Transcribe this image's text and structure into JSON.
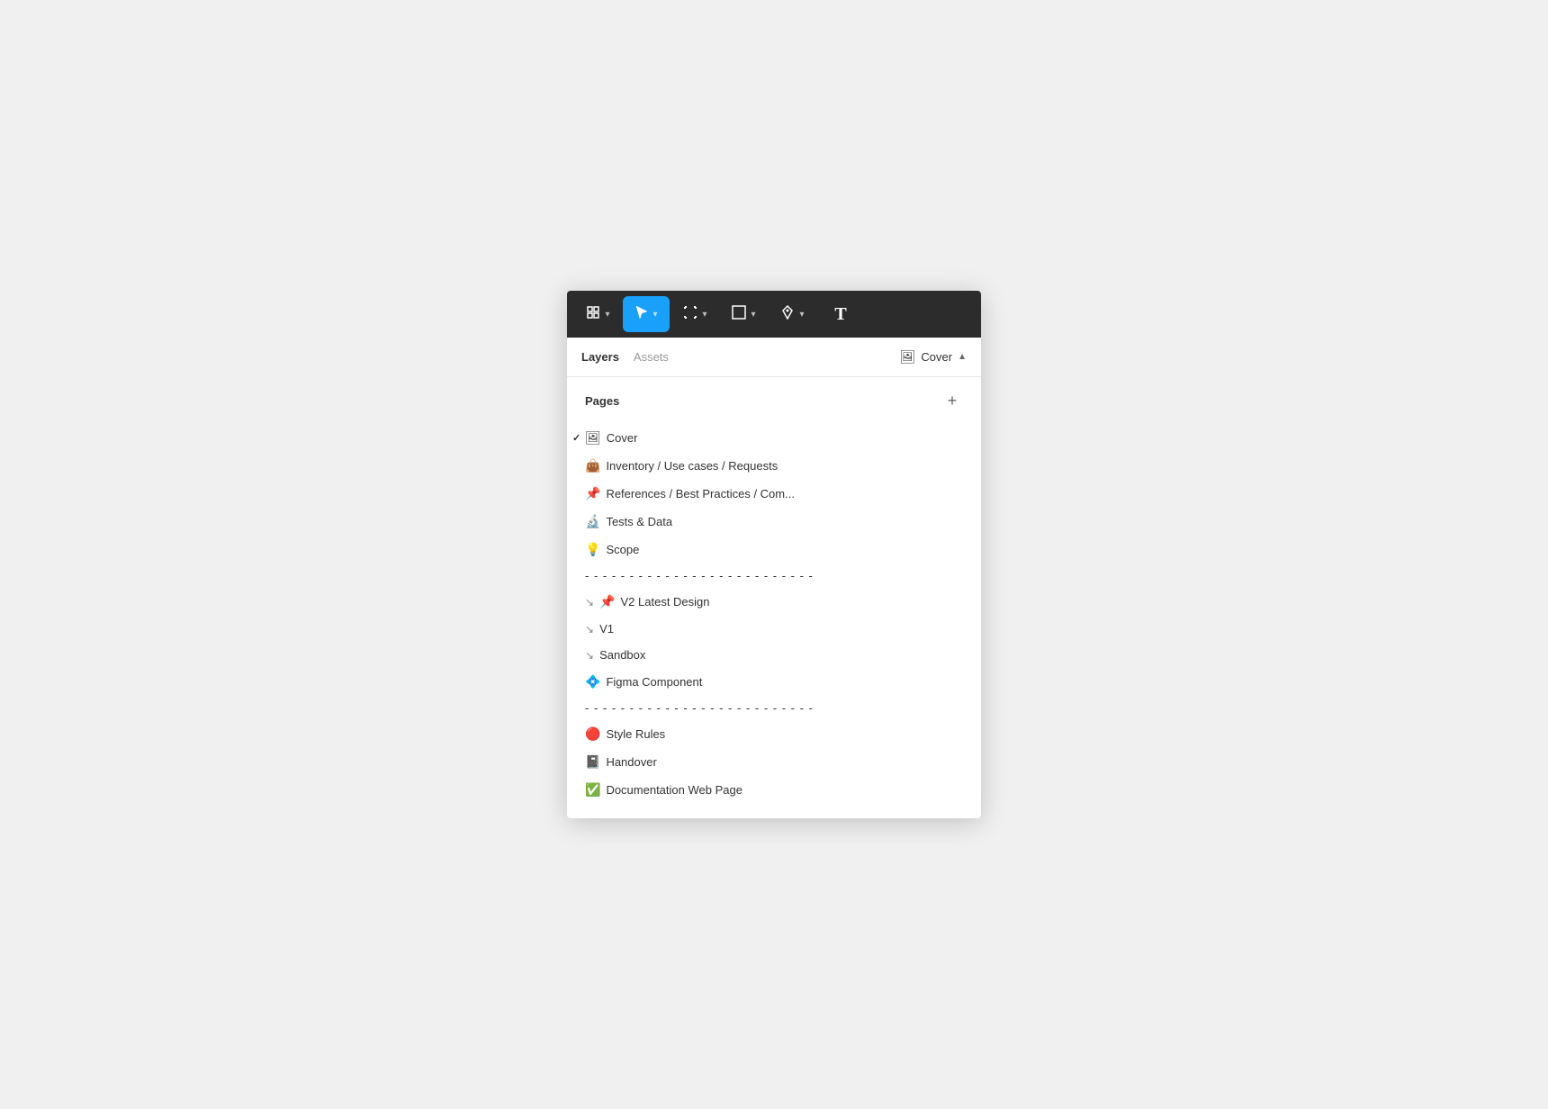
{
  "toolbar": {
    "tools": [
      {
        "id": "component",
        "icon": "⊞",
        "label": "Component tool",
        "active": false,
        "hasChevron": true
      },
      {
        "id": "cursor",
        "icon": "↖",
        "label": "Cursor tool",
        "active": true,
        "hasChevron": true
      },
      {
        "id": "frame",
        "icon": "#",
        "label": "Frame tool",
        "active": false,
        "hasChevron": true
      },
      {
        "id": "shape",
        "icon": "□",
        "label": "Shape tool",
        "active": false,
        "hasChevron": true
      },
      {
        "id": "pen",
        "icon": "✒",
        "label": "Pen tool",
        "active": false,
        "hasChevron": true
      },
      {
        "id": "text",
        "icon": "T",
        "label": "Text tool",
        "active": false,
        "hasChevron": false
      }
    ]
  },
  "panel": {
    "layers_tab": "Layers",
    "assets_tab": "Assets",
    "current_page_icon": "🖼",
    "current_page_name": "Cover",
    "chevron": "▲"
  },
  "pages_section": {
    "title": "Pages",
    "add_button": "+",
    "items": [
      {
        "id": "cover",
        "emoji": "🖼",
        "name": "Cover",
        "checked": true,
        "linked": false,
        "separator": false
      },
      {
        "id": "inventory",
        "emoji": "👜",
        "name": "Inventory / Use cases / Requests",
        "checked": false,
        "linked": false,
        "separator": false
      },
      {
        "id": "references",
        "emoji": "📌",
        "name": "References  / Best Practices / Com...",
        "checked": false,
        "linked": false,
        "separator": false
      },
      {
        "id": "tests",
        "emoji": "🔬",
        "name": "Tests & Data",
        "checked": false,
        "linked": false,
        "separator": false
      },
      {
        "id": "scope",
        "emoji": "💡",
        "name": "Scope",
        "checked": false,
        "linked": false,
        "separator": false
      },
      {
        "id": "sep1",
        "emoji": "",
        "name": "- - - - - - - - - - - - - - - - - - - - - - - - - -",
        "checked": false,
        "linked": false,
        "separator": true
      },
      {
        "id": "v2",
        "emoji": "📌",
        "name": "V2  Latest Design",
        "checked": false,
        "linked": true,
        "separator": false
      },
      {
        "id": "v1",
        "emoji": "",
        "name": "V1",
        "checked": false,
        "linked": true,
        "separator": false
      },
      {
        "id": "sandbox",
        "emoji": "",
        "name": "Sandbox",
        "checked": false,
        "linked": true,
        "separator": false
      },
      {
        "id": "figma-component",
        "emoji": "💠",
        "name": "Figma Component",
        "checked": false,
        "linked": false,
        "separator": false
      },
      {
        "id": "sep2",
        "emoji": "",
        "name": "- - - - - - - - - - - - - - - - - - - - - - - - - -",
        "checked": false,
        "linked": false,
        "separator": true
      },
      {
        "id": "style-rules",
        "emoji": "🔴",
        "name": "Style Rules",
        "checked": false,
        "linked": false,
        "separator": false
      },
      {
        "id": "handover",
        "emoji": "📓",
        "name": "Handover",
        "checked": false,
        "linked": false,
        "separator": false
      },
      {
        "id": "documentation",
        "emoji": "✅",
        "name": "Documentation Web Page",
        "checked": false,
        "linked": false,
        "separator": false
      }
    ]
  }
}
